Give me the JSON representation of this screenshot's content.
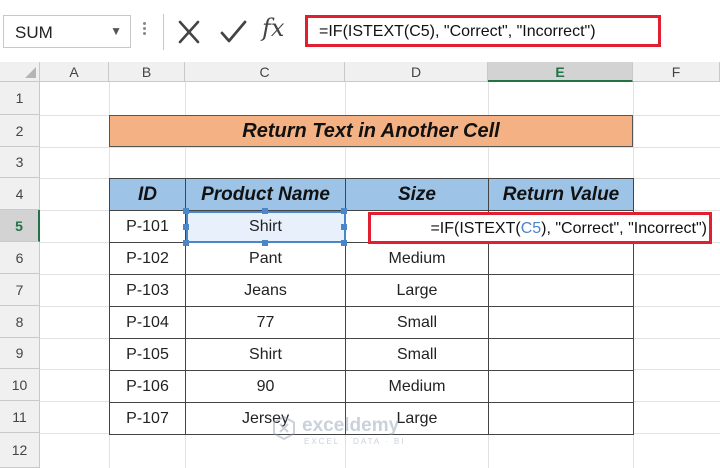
{
  "formula_bar": {
    "name_box": "SUM",
    "cancel_icon": "x-icon",
    "enter_icon": "check-icon",
    "fx_label": "fx",
    "formula": "=IF(ISTEXT(C5), \"Correct\", \"Incorrect\")"
  },
  "columns": [
    "A",
    "B",
    "C",
    "D",
    "E",
    "F"
  ],
  "selected_column": "E",
  "rows": [
    "1",
    "2",
    "3",
    "4",
    "5",
    "6",
    "7",
    "8",
    "9",
    "10",
    "11",
    "12"
  ],
  "selected_row": "5",
  "title": "Return Text in Another Cell",
  "table": {
    "headers": [
      "ID",
      "Product Name",
      "Size",
      "Return Value"
    ],
    "rows": [
      [
        "P-101",
        "Shirt",
        "",
        ""
      ],
      [
        "P-102",
        "Pant",
        "Medium",
        ""
      ],
      [
        "P-103",
        "Jeans",
        "Large",
        ""
      ],
      [
        "P-104",
        "77",
        "Small",
        ""
      ],
      [
        "P-105",
        "Shirt",
        "Small",
        ""
      ],
      [
        "P-106",
        "90",
        "Medium",
        ""
      ],
      [
        "P-107",
        "Jersey",
        "Large",
        ""
      ]
    ]
  },
  "cell_edit": {
    "prefix": "=IF(ISTEXT(",
    "ref": "C5",
    "suffix": "), \"Correct\", \"Incorrect\")"
  },
  "watermark": {
    "name": "exceldemy",
    "tagline": "EXCEL · DATA · BI"
  },
  "colors": {
    "highlight_border": "#e02030",
    "title_fill": "#f4b183",
    "header_fill": "#9dc3e6",
    "selection": "#4a86c8",
    "excel_green": "#217346"
  }
}
